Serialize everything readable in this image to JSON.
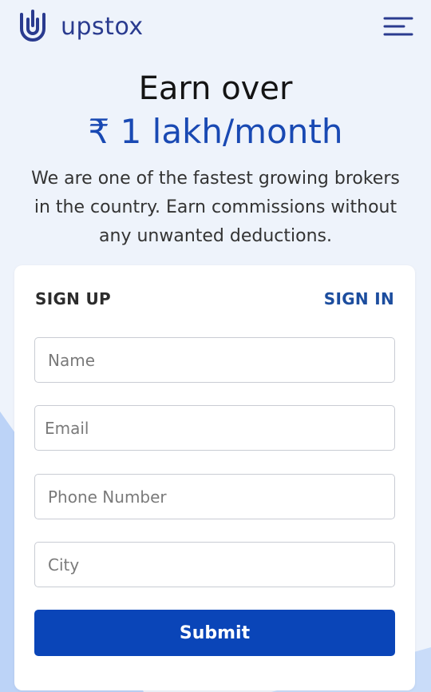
{
  "header": {
    "brand_name": "upstox",
    "logo_icon": "upstox-logo-icon",
    "menu_icon": "hamburger-menu-icon"
  },
  "hero": {
    "line1": "Earn over",
    "line2": "₹ 1 lakh/month",
    "description": "We are one of the fastest growing brokers in the country. Earn commissions without any unwanted deductions."
  },
  "form": {
    "tab_signup": "SIGN UP",
    "tab_signin": "SIGN IN",
    "name_placeholder": "Name",
    "email_placeholder": "Email",
    "phone_placeholder": "Phone Number",
    "city_placeholder": "City",
    "submit_label": "Submit"
  },
  "colors": {
    "background": "#eef3fb",
    "accent_light_blue": "#bcd3f7",
    "brand_blue": "#1949b3",
    "button_blue": "#0a45b8",
    "link_blue": "#1c4d9e",
    "logo_blue": "#2a3b8f"
  }
}
